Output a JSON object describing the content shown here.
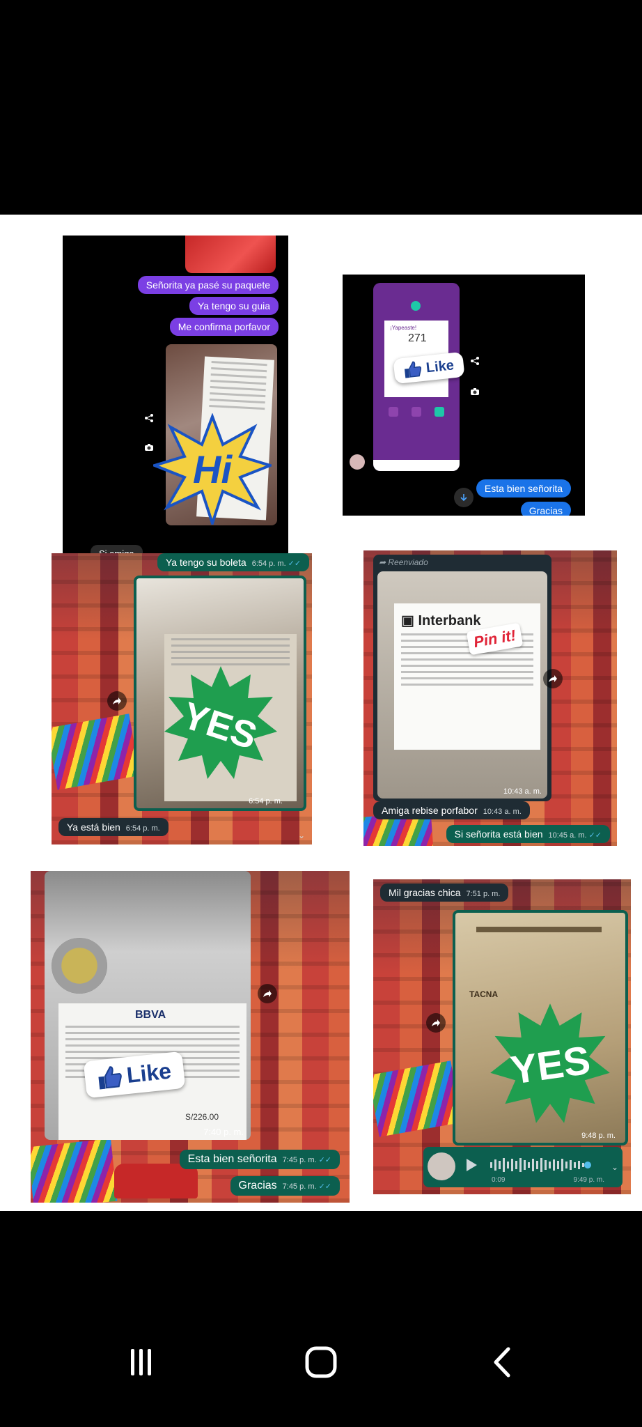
{
  "panel1": {
    "messages": [
      "Señorita ya pasé su paquete",
      "Ya tengo su guia",
      "Me confirma porfavor"
    ],
    "reply": "Si amiga",
    "sticker": "Hi"
  },
  "panel2": {
    "card_title": "¡Yapeaste!",
    "amount": "271",
    "sticker": "Like",
    "messages": [
      "Esta bien señorita",
      "Gracias"
    ]
  },
  "panel3": {
    "top_message": {
      "text": "Ya tengo su boleta",
      "time": "6:54 p. m."
    },
    "photo_time": "6:54 p. m.",
    "bottom_message": {
      "text": "Ya está bien",
      "time": "6:54 p. m."
    },
    "sticker": "YES"
  },
  "panel4": {
    "forwarded_label": "Reenviado",
    "bank_name": "Interbank",
    "pinit": "Pin it!",
    "photo_time": "10:43 a. m.",
    "message1": {
      "text": "Amiga rebise porfabor",
      "time": "10:43 a. m."
    },
    "message2": {
      "text": "Si señorita está bien",
      "time": "10:45 a. m."
    }
  },
  "panel5": {
    "bank_name": "BBVA",
    "amount": "S/226.00",
    "sticker": "Like",
    "photo_time": "7:40 p. m.",
    "message1": {
      "text": "Esta bien señorita",
      "time": "7:45 p. m."
    },
    "message2": {
      "text": "Gracias",
      "time": "7:45 p. m."
    }
  },
  "panel6": {
    "top_message": {
      "text": "Mil gracias chica",
      "time": "7:51 p. m."
    },
    "doc_city": "TACNA",
    "photo_time": "9:48 p. m.",
    "sticker": "YES",
    "voice_duration": "0:09",
    "voice_time": "9:49 p. m."
  },
  "icons": {
    "recents": "recents-icon",
    "home": "home-icon",
    "back": "back-icon",
    "share": "share-icon",
    "camera": "camera-icon",
    "forward": "forward-icon",
    "play": "play-icon",
    "scroll_down": "chevron-down-icon"
  },
  "colors": {
    "whatsapp_bubble": "#0c5f4f",
    "messenger_purple": "#7b3fe4",
    "messenger_blue": "#1a73e8",
    "sticker_green": "#1f9e4f",
    "hi_yellow": "#f4d03f",
    "hi_blue": "#1a54c4"
  }
}
